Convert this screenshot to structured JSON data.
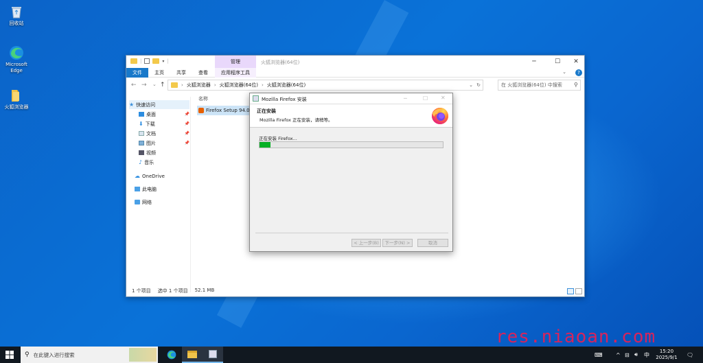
{
  "desktop": {
    "icons": [
      {
        "label": "回收站",
        "icon": "recycle-bin-icon"
      },
      {
        "label": "Microsoft Edge",
        "icon": "edge-icon"
      },
      {
        "label": "火狐浏览器",
        "icon": "folder-icon"
      }
    ],
    "watermark": "res.niaoan.com"
  },
  "explorer": {
    "context_tab": "管理",
    "title": "火狐浏览器(64位)",
    "ribbon_tabs": [
      "文件",
      "主页",
      "共享",
      "查看",
      "应用程序工具"
    ],
    "breadcrumb": [
      "火狐浏览器",
      "火狐浏览器(64位)",
      "火狐浏览器(64位)"
    ],
    "search_placeholder": "在 火狐浏览器(64位) 中搜索",
    "nav": {
      "quick_access": "快速访问",
      "items": [
        "桌面",
        "下载",
        "文档",
        "图片",
        "视频",
        "音乐"
      ],
      "onedrive": "OneDrive",
      "this_pc": "此电脑",
      "network": "网络"
    },
    "column_name": "名称",
    "file_name": "Firefox Setup 94.0",
    "status": {
      "count": "1 个项目",
      "selected": "选中 1 个项目",
      "size": "52.1 MB"
    }
  },
  "installer": {
    "title": "Mozilla Firefox 安装",
    "header_title": "正在安装",
    "header_subtitle": "Mozilla Firefox 正在安装，请稍等。",
    "status_text": "正在安装 Firefox...",
    "progress": 0.06,
    "buttons": {
      "back": "< 上一步(B)",
      "next": "下一步(N) >",
      "cancel": "取消"
    },
    "accent": "#06b025"
  },
  "taskbar": {
    "search_placeholder": "在此键入进行搜索",
    "ime": "中",
    "time": "15:20",
    "date": "2025/9/1"
  }
}
